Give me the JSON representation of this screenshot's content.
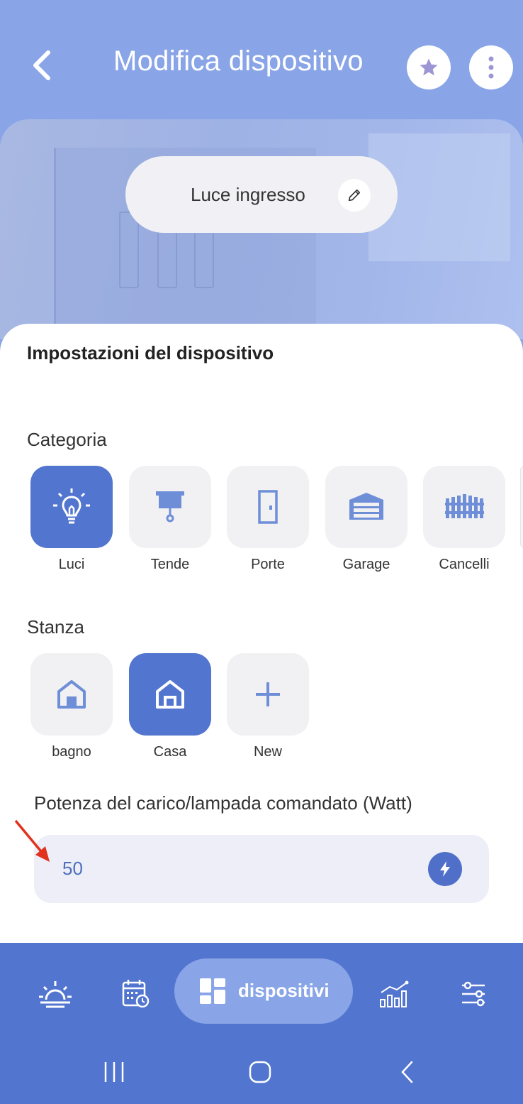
{
  "header": {
    "title": "Modifica dispositivo"
  },
  "device": {
    "name": "Luce ingresso"
  },
  "settings": {
    "title": "Impostazioni del dispositivo",
    "category_label": "Categoria",
    "categories": [
      {
        "label": "Luci",
        "icon": "lightbulb-icon",
        "selected": true
      },
      {
        "label": "Tende",
        "icon": "curtain-icon",
        "selected": false
      },
      {
        "label": "Porte",
        "icon": "door-icon",
        "selected": false
      },
      {
        "label": "Garage",
        "icon": "garage-icon",
        "selected": false
      },
      {
        "label": "Cancelli",
        "icon": "gate-icon",
        "selected": false
      }
    ],
    "room_label": "Stanza",
    "rooms": [
      {
        "label": "bagno",
        "icon": "home-icon",
        "selected": false
      },
      {
        "label": "Casa",
        "icon": "home-icon",
        "selected": true
      },
      {
        "label": "New",
        "icon": "plus-icon",
        "selected": false
      }
    ],
    "power_label": "Potenza del carico/lampada comandato (Watt)",
    "power_value": "50"
  },
  "nav": {
    "active_label": "dispositivi"
  },
  "colors": {
    "header_bg": "#89a5e7",
    "accent": "#5275cf",
    "tile_bg": "#f1f1f3",
    "arrow": "#e0321c"
  }
}
